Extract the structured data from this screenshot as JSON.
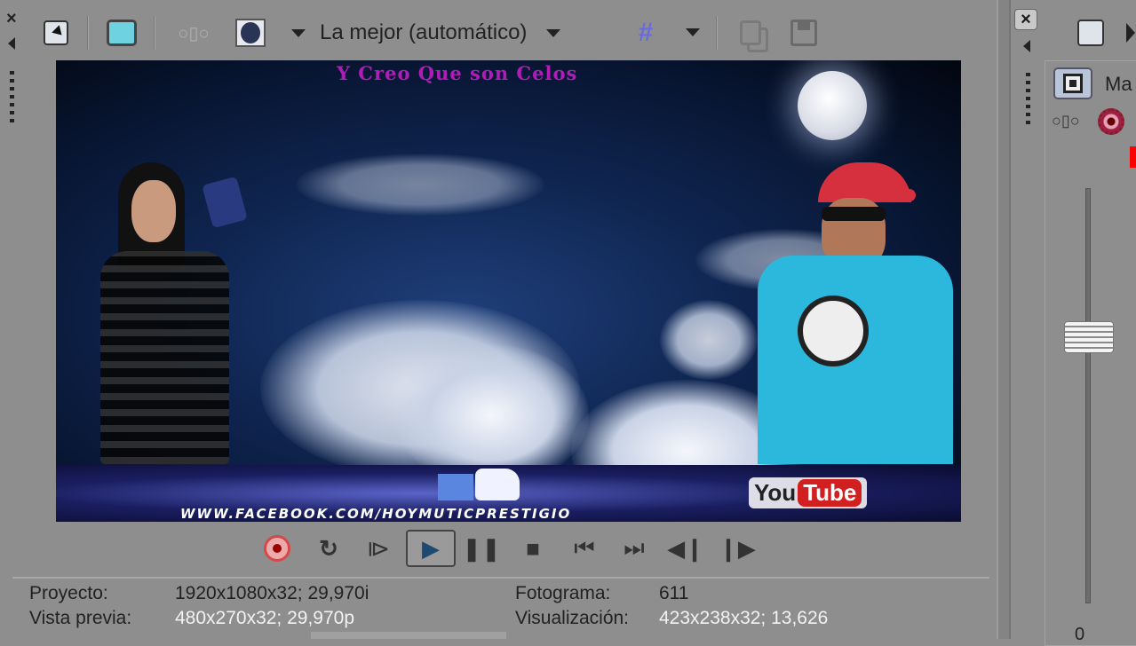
{
  "toolbar": {
    "quality_label": "La mejor (automático)"
  },
  "video": {
    "title_text": "Y Creo Que son Celos",
    "footer_url": "WWW.FACEBOOK.COM/HOYMUTICPRESTIGIO",
    "youtube_you": "You",
    "youtube_tube": "Tube"
  },
  "info": {
    "project_label": "Proyecto:",
    "project_value": "1920x1080x32; 29,970i",
    "preview_label": "Vista previa:",
    "preview_value": "480x270x32; 29,970p",
    "frame_label": "Fotograma:",
    "frame_value": "611",
    "display_label": "Visualización:",
    "display_value": "423x238x32; 13,626"
  },
  "right_panel": {
    "master_label": "Ma",
    "slider_value_label": "0"
  },
  "colors": {
    "background": "#8e8e8e",
    "record": "#d44a4a",
    "accent_text": "#b01cb8"
  }
}
